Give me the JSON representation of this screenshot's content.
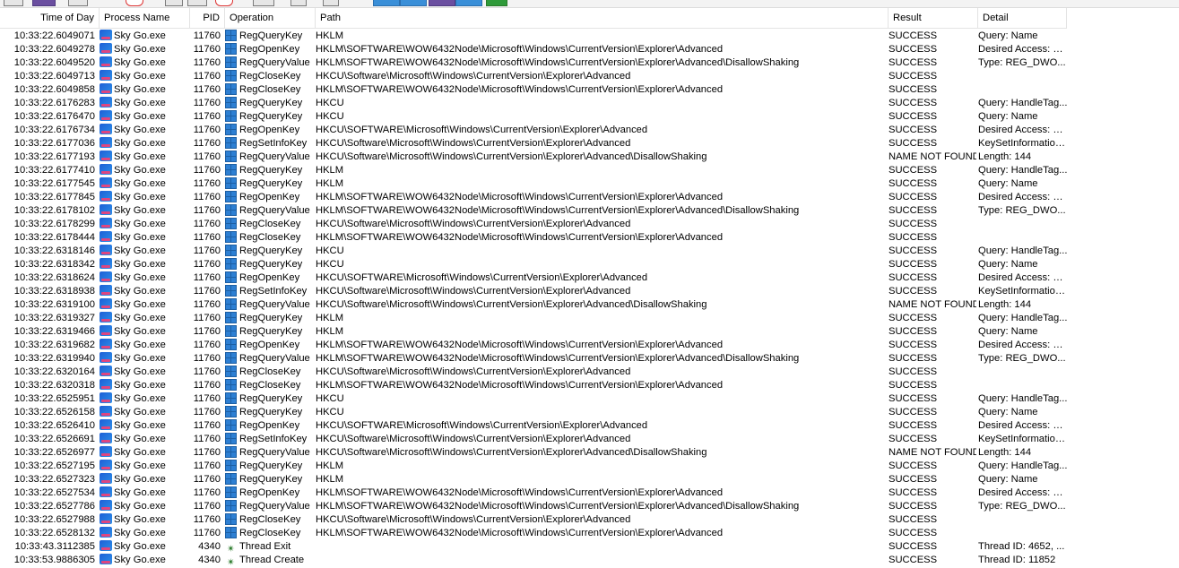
{
  "headers": {
    "time": "Time of Day",
    "process": "Process Name",
    "pid": "PID",
    "operation": "Operation",
    "path": "Path",
    "result": "Result",
    "detail": "Detail"
  },
  "icons": {
    "process": "sky-go-icon",
    "registry": "registry-icon",
    "thread": "thread-icon"
  },
  "colors": {
    "selected_toolbar": "#3a8fd8"
  },
  "rows": [
    {
      "time": "10:33:22.6049071",
      "proc": "Sky Go.exe",
      "pid": "11760",
      "op": "RegQueryKey",
      "path": "HKLM",
      "res": "SUCCESS",
      "det": "Query: Name",
      "icon": "registry"
    },
    {
      "time": "10:33:22.6049278",
      "proc": "Sky Go.exe",
      "pid": "11760",
      "op": "RegOpenKey",
      "path": "HKLM\\SOFTWARE\\WOW6432Node\\Microsoft\\Windows\\CurrentVersion\\Explorer\\Advanced",
      "res": "SUCCESS",
      "det": "Desired Access: Q...",
      "icon": "registry"
    },
    {
      "time": "10:33:22.6049520",
      "proc": "Sky Go.exe",
      "pid": "11760",
      "op": "RegQueryValue",
      "path": "HKLM\\SOFTWARE\\WOW6432Node\\Microsoft\\Windows\\CurrentVersion\\Explorer\\Advanced\\DisallowShaking",
      "res": "SUCCESS",
      "det": "Type: REG_DWO...",
      "icon": "registry"
    },
    {
      "time": "10:33:22.6049713",
      "proc": "Sky Go.exe",
      "pid": "11760",
      "op": "RegCloseKey",
      "path": "HKCU\\Software\\Microsoft\\Windows\\CurrentVersion\\Explorer\\Advanced",
      "res": "SUCCESS",
      "det": "",
      "icon": "registry"
    },
    {
      "time": "10:33:22.6049858",
      "proc": "Sky Go.exe",
      "pid": "11760",
      "op": "RegCloseKey",
      "path": "HKLM\\SOFTWARE\\WOW6432Node\\Microsoft\\Windows\\CurrentVersion\\Explorer\\Advanced",
      "res": "SUCCESS",
      "det": "",
      "icon": "registry"
    },
    {
      "time": "10:33:22.6176283",
      "proc": "Sky Go.exe",
      "pid": "11760",
      "op": "RegQueryKey",
      "path": "HKCU",
      "res": "SUCCESS",
      "det": "Query: HandleTag...",
      "icon": "registry"
    },
    {
      "time": "10:33:22.6176470",
      "proc": "Sky Go.exe",
      "pid": "11760",
      "op": "RegQueryKey",
      "path": "HKCU",
      "res": "SUCCESS",
      "det": "Query: Name",
      "icon": "registry"
    },
    {
      "time": "10:33:22.6176734",
      "proc": "Sky Go.exe",
      "pid": "11760",
      "op": "RegOpenKey",
      "path": "HKCU\\SOFTWARE\\Microsoft\\Windows\\CurrentVersion\\Explorer\\Advanced",
      "res": "SUCCESS",
      "det": "Desired Access: Q...",
      "icon": "registry"
    },
    {
      "time": "10:33:22.6177036",
      "proc": "Sky Go.exe",
      "pid": "11760",
      "op": "RegSetInfoKey",
      "path": "HKCU\\Software\\Microsoft\\Windows\\CurrentVersion\\Explorer\\Advanced",
      "res": "SUCCESS",
      "det": "KeySetInformation...",
      "icon": "registry"
    },
    {
      "time": "10:33:22.6177193",
      "proc": "Sky Go.exe",
      "pid": "11760",
      "op": "RegQueryValue",
      "path": "HKCU\\Software\\Microsoft\\Windows\\CurrentVersion\\Explorer\\Advanced\\DisallowShaking",
      "res": "NAME NOT FOUND",
      "det": "Length: 144",
      "icon": "registry"
    },
    {
      "time": "10:33:22.6177410",
      "proc": "Sky Go.exe",
      "pid": "11760",
      "op": "RegQueryKey",
      "path": "HKLM",
      "res": "SUCCESS",
      "det": "Query: HandleTag...",
      "icon": "registry"
    },
    {
      "time": "10:33:22.6177545",
      "proc": "Sky Go.exe",
      "pid": "11760",
      "op": "RegQueryKey",
      "path": "HKLM",
      "res": "SUCCESS",
      "det": "Query: Name",
      "icon": "registry"
    },
    {
      "time": "10:33:22.6177845",
      "proc": "Sky Go.exe",
      "pid": "11760",
      "op": "RegOpenKey",
      "path": "HKLM\\SOFTWARE\\WOW6432Node\\Microsoft\\Windows\\CurrentVersion\\Explorer\\Advanced",
      "res": "SUCCESS",
      "det": "Desired Access: Q...",
      "icon": "registry"
    },
    {
      "time": "10:33:22.6178102",
      "proc": "Sky Go.exe",
      "pid": "11760",
      "op": "RegQueryValue",
      "path": "HKLM\\SOFTWARE\\WOW6432Node\\Microsoft\\Windows\\CurrentVersion\\Explorer\\Advanced\\DisallowShaking",
      "res": "SUCCESS",
      "det": "Type: REG_DWO...",
      "icon": "registry"
    },
    {
      "time": "10:33:22.6178299",
      "proc": "Sky Go.exe",
      "pid": "11760",
      "op": "RegCloseKey",
      "path": "HKCU\\Software\\Microsoft\\Windows\\CurrentVersion\\Explorer\\Advanced",
      "res": "SUCCESS",
      "det": "",
      "icon": "registry"
    },
    {
      "time": "10:33:22.6178444",
      "proc": "Sky Go.exe",
      "pid": "11760",
      "op": "RegCloseKey",
      "path": "HKLM\\SOFTWARE\\WOW6432Node\\Microsoft\\Windows\\CurrentVersion\\Explorer\\Advanced",
      "res": "SUCCESS",
      "det": "",
      "icon": "registry"
    },
    {
      "time": "10:33:22.6318146",
      "proc": "Sky Go.exe",
      "pid": "11760",
      "op": "RegQueryKey",
      "path": "HKCU",
      "res": "SUCCESS",
      "det": "Query: HandleTag...",
      "icon": "registry"
    },
    {
      "time": "10:33:22.6318342",
      "proc": "Sky Go.exe",
      "pid": "11760",
      "op": "RegQueryKey",
      "path": "HKCU",
      "res": "SUCCESS",
      "det": "Query: Name",
      "icon": "registry"
    },
    {
      "time": "10:33:22.6318624",
      "proc": "Sky Go.exe",
      "pid": "11760",
      "op": "RegOpenKey",
      "path": "HKCU\\SOFTWARE\\Microsoft\\Windows\\CurrentVersion\\Explorer\\Advanced",
      "res": "SUCCESS",
      "det": "Desired Access: Q...",
      "icon": "registry"
    },
    {
      "time": "10:33:22.6318938",
      "proc": "Sky Go.exe",
      "pid": "11760",
      "op": "RegSetInfoKey",
      "path": "HKCU\\Software\\Microsoft\\Windows\\CurrentVersion\\Explorer\\Advanced",
      "res": "SUCCESS",
      "det": "KeySetInformation...",
      "icon": "registry"
    },
    {
      "time": "10:33:22.6319100",
      "proc": "Sky Go.exe",
      "pid": "11760",
      "op": "RegQueryValue",
      "path": "HKCU\\Software\\Microsoft\\Windows\\CurrentVersion\\Explorer\\Advanced\\DisallowShaking",
      "res": "NAME NOT FOUND",
      "det": "Length: 144",
      "icon": "registry"
    },
    {
      "time": "10:33:22.6319327",
      "proc": "Sky Go.exe",
      "pid": "11760",
      "op": "RegQueryKey",
      "path": "HKLM",
      "res": "SUCCESS",
      "det": "Query: HandleTag...",
      "icon": "registry"
    },
    {
      "time": "10:33:22.6319466",
      "proc": "Sky Go.exe",
      "pid": "11760",
      "op": "RegQueryKey",
      "path": "HKLM",
      "res": "SUCCESS",
      "det": "Query: Name",
      "icon": "registry"
    },
    {
      "time": "10:33:22.6319682",
      "proc": "Sky Go.exe",
      "pid": "11760",
      "op": "RegOpenKey",
      "path": "HKLM\\SOFTWARE\\WOW6432Node\\Microsoft\\Windows\\CurrentVersion\\Explorer\\Advanced",
      "res": "SUCCESS",
      "det": "Desired Access: Q...",
      "icon": "registry"
    },
    {
      "time": "10:33:22.6319940",
      "proc": "Sky Go.exe",
      "pid": "11760",
      "op": "RegQueryValue",
      "path": "HKLM\\SOFTWARE\\WOW6432Node\\Microsoft\\Windows\\CurrentVersion\\Explorer\\Advanced\\DisallowShaking",
      "res": "SUCCESS",
      "det": "Type: REG_DWO...",
      "icon": "registry"
    },
    {
      "time": "10:33:22.6320164",
      "proc": "Sky Go.exe",
      "pid": "11760",
      "op": "RegCloseKey",
      "path": "HKCU\\Software\\Microsoft\\Windows\\CurrentVersion\\Explorer\\Advanced",
      "res": "SUCCESS",
      "det": "",
      "icon": "registry"
    },
    {
      "time": "10:33:22.6320318",
      "proc": "Sky Go.exe",
      "pid": "11760",
      "op": "RegCloseKey",
      "path": "HKLM\\SOFTWARE\\WOW6432Node\\Microsoft\\Windows\\CurrentVersion\\Explorer\\Advanced",
      "res": "SUCCESS",
      "det": "",
      "icon": "registry"
    },
    {
      "time": "10:33:22.6525951",
      "proc": "Sky Go.exe",
      "pid": "11760",
      "op": "RegQueryKey",
      "path": "HKCU",
      "res": "SUCCESS",
      "det": "Query: HandleTag...",
      "icon": "registry"
    },
    {
      "time": "10:33:22.6526158",
      "proc": "Sky Go.exe",
      "pid": "11760",
      "op": "RegQueryKey",
      "path": "HKCU",
      "res": "SUCCESS",
      "det": "Query: Name",
      "icon": "registry"
    },
    {
      "time": "10:33:22.6526410",
      "proc": "Sky Go.exe",
      "pid": "11760",
      "op": "RegOpenKey",
      "path": "HKCU\\SOFTWARE\\Microsoft\\Windows\\CurrentVersion\\Explorer\\Advanced",
      "res": "SUCCESS",
      "det": "Desired Access: Q...",
      "icon": "registry"
    },
    {
      "time": "10:33:22.6526691",
      "proc": "Sky Go.exe",
      "pid": "11760",
      "op": "RegSetInfoKey",
      "path": "HKCU\\Software\\Microsoft\\Windows\\CurrentVersion\\Explorer\\Advanced",
      "res": "SUCCESS",
      "det": "KeySetInformation...",
      "icon": "registry"
    },
    {
      "time": "10:33:22.6526977",
      "proc": "Sky Go.exe",
      "pid": "11760",
      "op": "RegQueryValue",
      "path": "HKCU\\Software\\Microsoft\\Windows\\CurrentVersion\\Explorer\\Advanced\\DisallowShaking",
      "res": "NAME NOT FOUND",
      "det": "Length: 144",
      "icon": "registry"
    },
    {
      "time": "10:33:22.6527195",
      "proc": "Sky Go.exe",
      "pid": "11760",
      "op": "RegQueryKey",
      "path": "HKLM",
      "res": "SUCCESS",
      "det": "Query: HandleTag...",
      "icon": "registry"
    },
    {
      "time": "10:33:22.6527323",
      "proc": "Sky Go.exe",
      "pid": "11760",
      "op": "RegQueryKey",
      "path": "HKLM",
      "res": "SUCCESS",
      "det": "Query: Name",
      "icon": "registry"
    },
    {
      "time": "10:33:22.6527534",
      "proc": "Sky Go.exe",
      "pid": "11760",
      "op": "RegOpenKey",
      "path": "HKLM\\SOFTWARE\\WOW6432Node\\Microsoft\\Windows\\CurrentVersion\\Explorer\\Advanced",
      "res": "SUCCESS",
      "det": "Desired Access: Q...",
      "icon": "registry"
    },
    {
      "time": "10:33:22.6527786",
      "proc": "Sky Go.exe",
      "pid": "11760",
      "op": "RegQueryValue",
      "path": "HKLM\\SOFTWARE\\WOW6432Node\\Microsoft\\Windows\\CurrentVersion\\Explorer\\Advanced\\DisallowShaking",
      "res": "SUCCESS",
      "det": "Type: REG_DWO...",
      "icon": "registry"
    },
    {
      "time": "10:33:22.6527988",
      "proc": "Sky Go.exe",
      "pid": "11760",
      "op": "RegCloseKey",
      "path": "HKCU\\Software\\Microsoft\\Windows\\CurrentVersion\\Explorer\\Advanced",
      "res": "SUCCESS",
      "det": "",
      "icon": "registry"
    },
    {
      "time": "10:33:22.6528132",
      "proc": "Sky Go.exe",
      "pid": "11760",
      "op": "RegCloseKey",
      "path": "HKLM\\SOFTWARE\\WOW6432Node\\Microsoft\\Windows\\CurrentVersion\\Explorer\\Advanced",
      "res": "SUCCESS",
      "det": "",
      "icon": "registry"
    },
    {
      "time": "10:33:43.3112385",
      "proc": "Sky Go.exe",
      "pid": "4340",
      "op": "Thread Exit",
      "path": "",
      "res": "SUCCESS",
      "det": "Thread ID: 4652, ...",
      "icon": "thread"
    },
    {
      "time": "10:33:53.9886305",
      "proc": "Sky Go.exe",
      "pid": "4340",
      "op": "Thread Create",
      "path": "",
      "res": "SUCCESS",
      "det": "Thread ID: 11852",
      "icon": "thread"
    }
  ]
}
